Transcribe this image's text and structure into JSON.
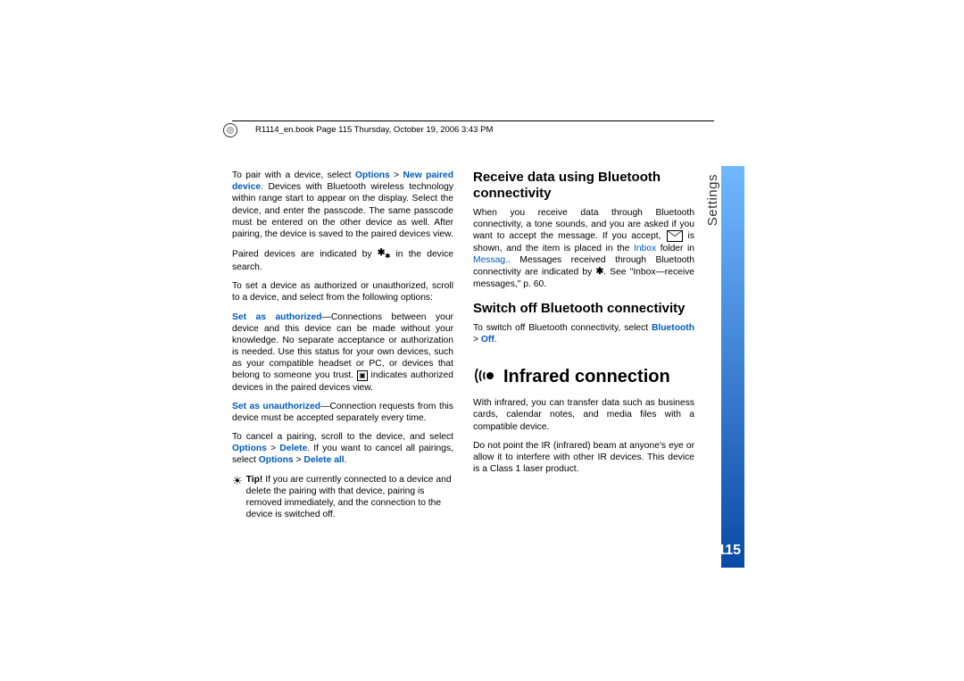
{
  "header": "R1114_en.book  Page 115  Thursday, October 19, 2006  3:43 PM",
  "tab": "Settings",
  "pageNum": "115",
  "col1": {
    "p1a": "To pair with a device, select ",
    "p1_opt": "Options",
    "p1_gt": " > ",
    "p1_npd": "New paired device",
    "p1b": ". Devices with Bluetooth wireless technology within range start to appear on the display. Select the device, and enter the passcode. The same passcode must be entered on the other device as well. After pairing, the device is saved to the paired devices view.",
    "p2a": "Paired devices are indicated by ",
    "p2b": " in the device search.",
    "p3": "To set a device as authorized or unauthorized, scroll to a device, and select from the following options:",
    "p4_label": "Set as authorized",
    "p4": "—Connections between your device and this device can be made without your knowledge. No separate acceptance or authorization is needed. Use this status for your own devices, such as your compatible headset or PC, or devices that belong to someone you trust. ",
    "p4b": " indicates authorized devices in the paired devices view.",
    "p5_label": "Set as unauthorized",
    "p5": "—Connection requests from this device must be accepted separately every time.",
    "p6a": "To cancel a pairing, scroll to the device, and select ",
    "p6_opt": "Options",
    "p6_gt": " > ",
    "p6_del": "Delete",
    "p6b": ". If you want to cancel all pairings, select ",
    "p6_opt2": "Options",
    "p6_gt2": " > ",
    "p6_delall": "Delete all",
    "p6c": ".",
    "tip_label": "Tip!",
    "tip": " If you are currently connected to a device and delete the pairing with that device, pairing is removed immediately, and the connection to the device is switched off."
  },
  "col2": {
    "h_recv": "Receive data using Bluetooth connectivity",
    "recv_a": "When you receive data through Bluetooth connectivity, a tone sounds, and you are asked if you want to accept the message. If you accept, ",
    "recv_b": " is shown, and the item is placed in the ",
    "recv_inbox": "Inbox",
    "recv_c": " folder in ",
    "recv_msg": "Messag.",
    "recv_d": ". Messages received through Bluetooth connectivity are indicated by ",
    "recv_e": ". See \"Inbox—receive messages,\" p. 60.",
    "h_switch": "Switch off Bluetooth connectivity",
    "switch_a": "To switch off Bluetooth connectivity, select ",
    "switch_bt": "Bluetooth",
    "switch_gt": " > ",
    "switch_off": "Off",
    "switch_b": ".",
    "h_ir": "Infrared connection",
    "ir_p1": "With infrared, you can transfer data such as business cards, calendar notes, and media files with a compatible device.",
    "ir_p2": "Do not point the IR (infrared) beam at anyone's eye or allow it to interfere with other IR devices. This device is a Class 1 laser product."
  }
}
